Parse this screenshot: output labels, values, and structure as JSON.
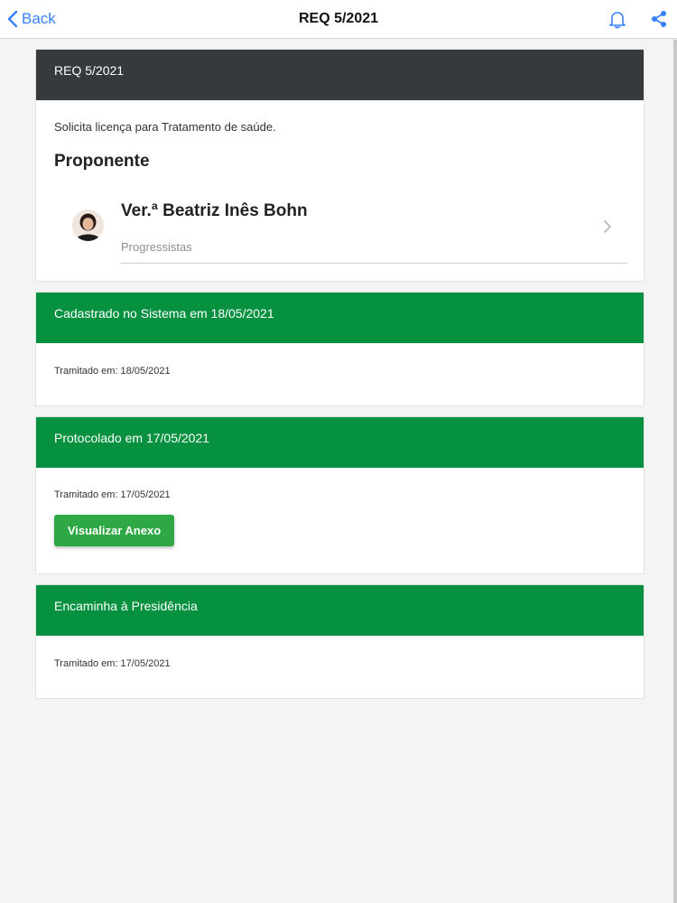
{
  "nav": {
    "back_label": "Back",
    "title": "REQ 5/2021",
    "bell_icon": "bell-icon",
    "share_icon": "share-icon"
  },
  "main_card": {
    "header": "REQ 5/2021",
    "description": "Solicita licença para Tratamento de saúde.",
    "section_title": "Proponente",
    "proponent": {
      "name": "Ver.ª Beatriz Inês Bohn",
      "party": "Progressistas",
      "avatar_icon": "avatar-photo"
    }
  },
  "steps": [
    {
      "title": "Cadastrado no Sistema em 18/05/2021",
      "tramitado": "Tramitado em: 18/05/2021"
    },
    {
      "title": "Protocolado em 17/05/2021",
      "tramitado": "Tramitado em: 17/05/2021",
      "button_label": "Visualizar Anexo"
    },
    {
      "title": "Encaminha à Presidência",
      "tramitado": "Tramitado em: 17/05/2021"
    }
  ],
  "colors": {
    "accent_blue": "#3880ff",
    "header_dark": "#373a3d",
    "step_green": "#05913f",
    "button_green": "#2ea844"
  }
}
